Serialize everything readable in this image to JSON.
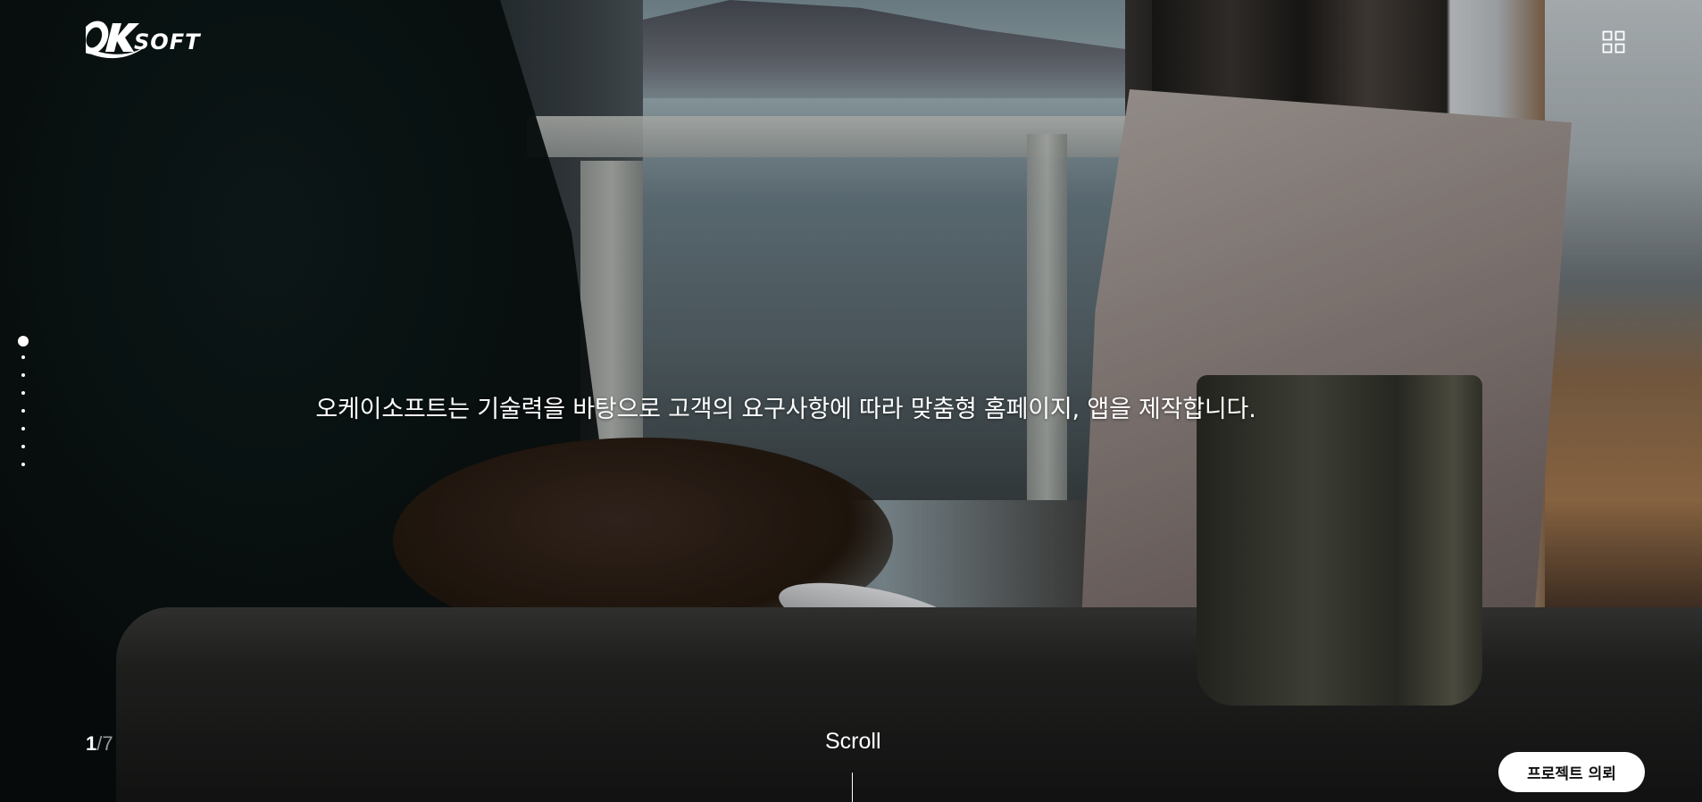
{
  "brand": {
    "logo_text": "OKSOFT",
    "logo_icon": "oksoft-logo"
  },
  "header": {
    "menu_icon": "grid-menu-icon"
  },
  "pagination": {
    "current": "1",
    "separator": "/",
    "total": "7",
    "dot_count": 8,
    "active_index": 0
  },
  "hero": {
    "headline": "오케이소프트는 기술력을 바탕으로 고객의 요구사항에 따라 맞춤형 홈페이지, 앱을 제작합니다."
  },
  "scroll": {
    "label": "Scroll"
  },
  "cta": {
    "label": "프로젝트 의뢰"
  }
}
